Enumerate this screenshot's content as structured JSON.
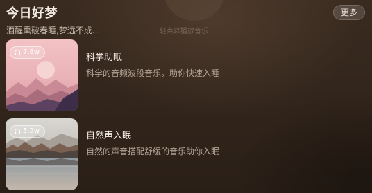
{
  "header": {
    "title": "今日好梦",
    "subtitle": "酒醒熏破春睡,梦远不成...",
    "more_label": "更多",
    "hint": "轻点以播放音乐"
  },
  "cards": [
    {
      "title": "科学助眠",
      "description": "科学的音频波段音乐，助你快速入睡",
      "plays": "7.8w",
      "icon": "headphone-icon"
    },
    {
      "title": "自然声入眠",
      "description": "自然的声音搭配舒缓的音乐助你入眠",
      "plays": "5.2w",
      "icon": "headphone-icon"
    }
  ],
  "colors": {
    "background": "#2e2219",
    "title": "#f4ece4",
    "subtitle": "#c7b9ab",
    "description": "#b3a395"
  }
}
